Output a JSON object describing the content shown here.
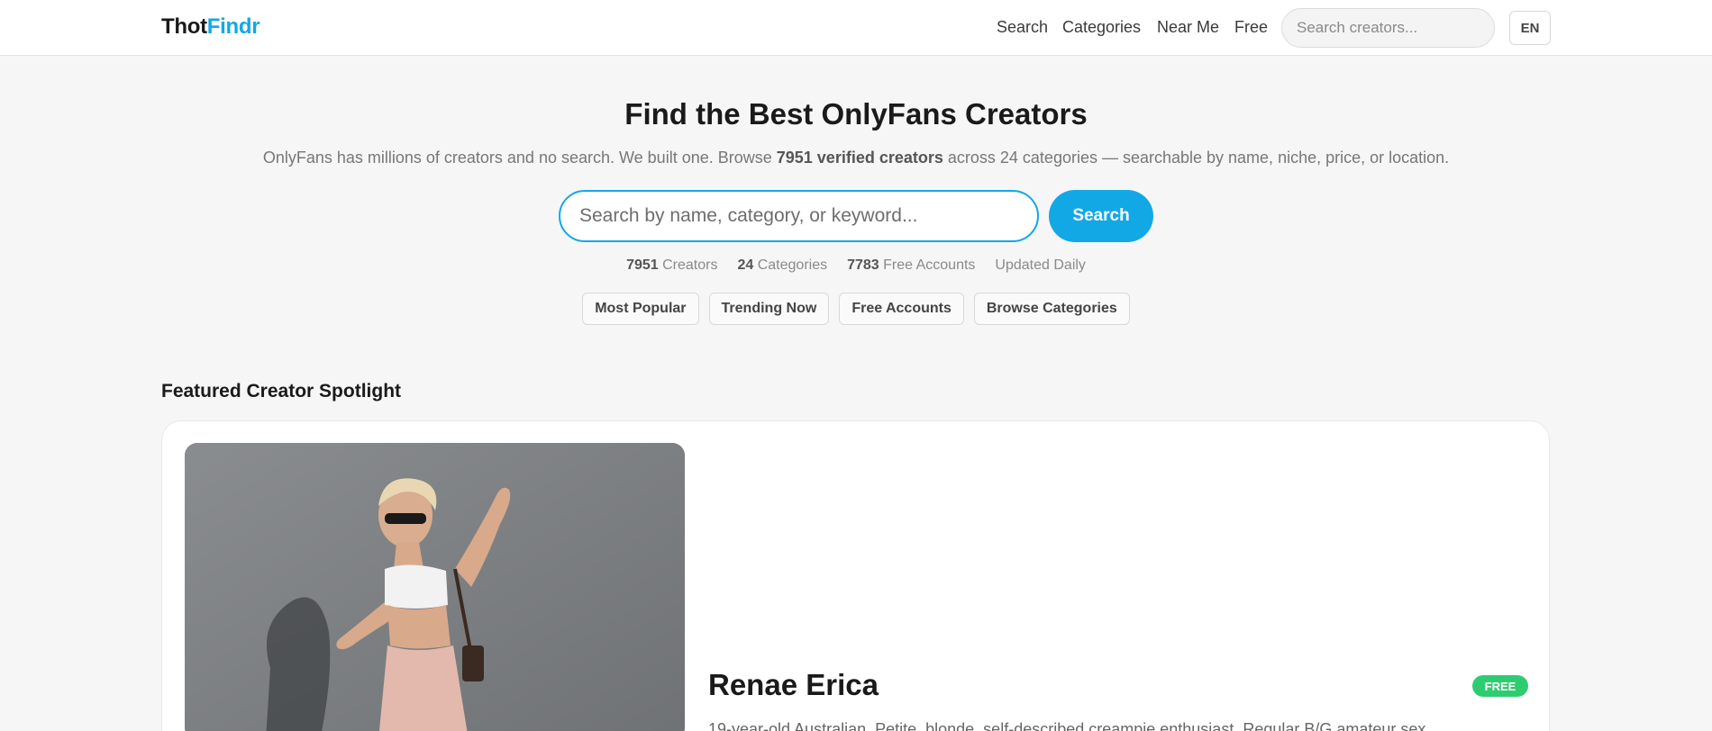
{
  "brand": {
    "part1": "Thot",
    "part2": "Findr"
  },
  "nav": {
    "links": [
      "Search",
      "Categories",
      "Near Me",
      "Free"
    ],
    "search_placeholder": "Search creators...",
    "lang": "EN"
  },
  "hero": {
    "title": "Find the Best OnlyFans Creators",
    "sub_before": "OnlyFans has millions of creators and no search. We built one. Browse ",
    "sub_bold": "7951 verified creators",
    "sub_after": " across 24 categories — searchable by name, niche, price, or location.",
    "search_placeholder": "Search by name, category, or keyword...",
    "search_button": "Search"
  },
  "stats": [
    {
      "value": "7951",
      "label": "Creators"
    },
    {
      "value": "24",
      "label": "Categories"
    },
    {
      "value": "7783",
      "label": "Free Accounts"
    },
    {
      "value": "",
      "label": "Updated Daily"
    }
  ],
  "chips": [
    "Most Popular",
    "Trending Now",
    "Free Accounts",
    "Browse Categories"
  ],
  "featured": {
    "section_title": "Featured Creator Spotlight",
    "name": "Renae Erica",
    "badge": "FREE",
    "bio": "19-year-old Australian. Petite, blonde, self-described creampie enthusiast. Regular B/G amateur sex"
  },
  "colors": {
    "accent": "#12a8e6",
    "free": "#2ecc71"
  }
}
